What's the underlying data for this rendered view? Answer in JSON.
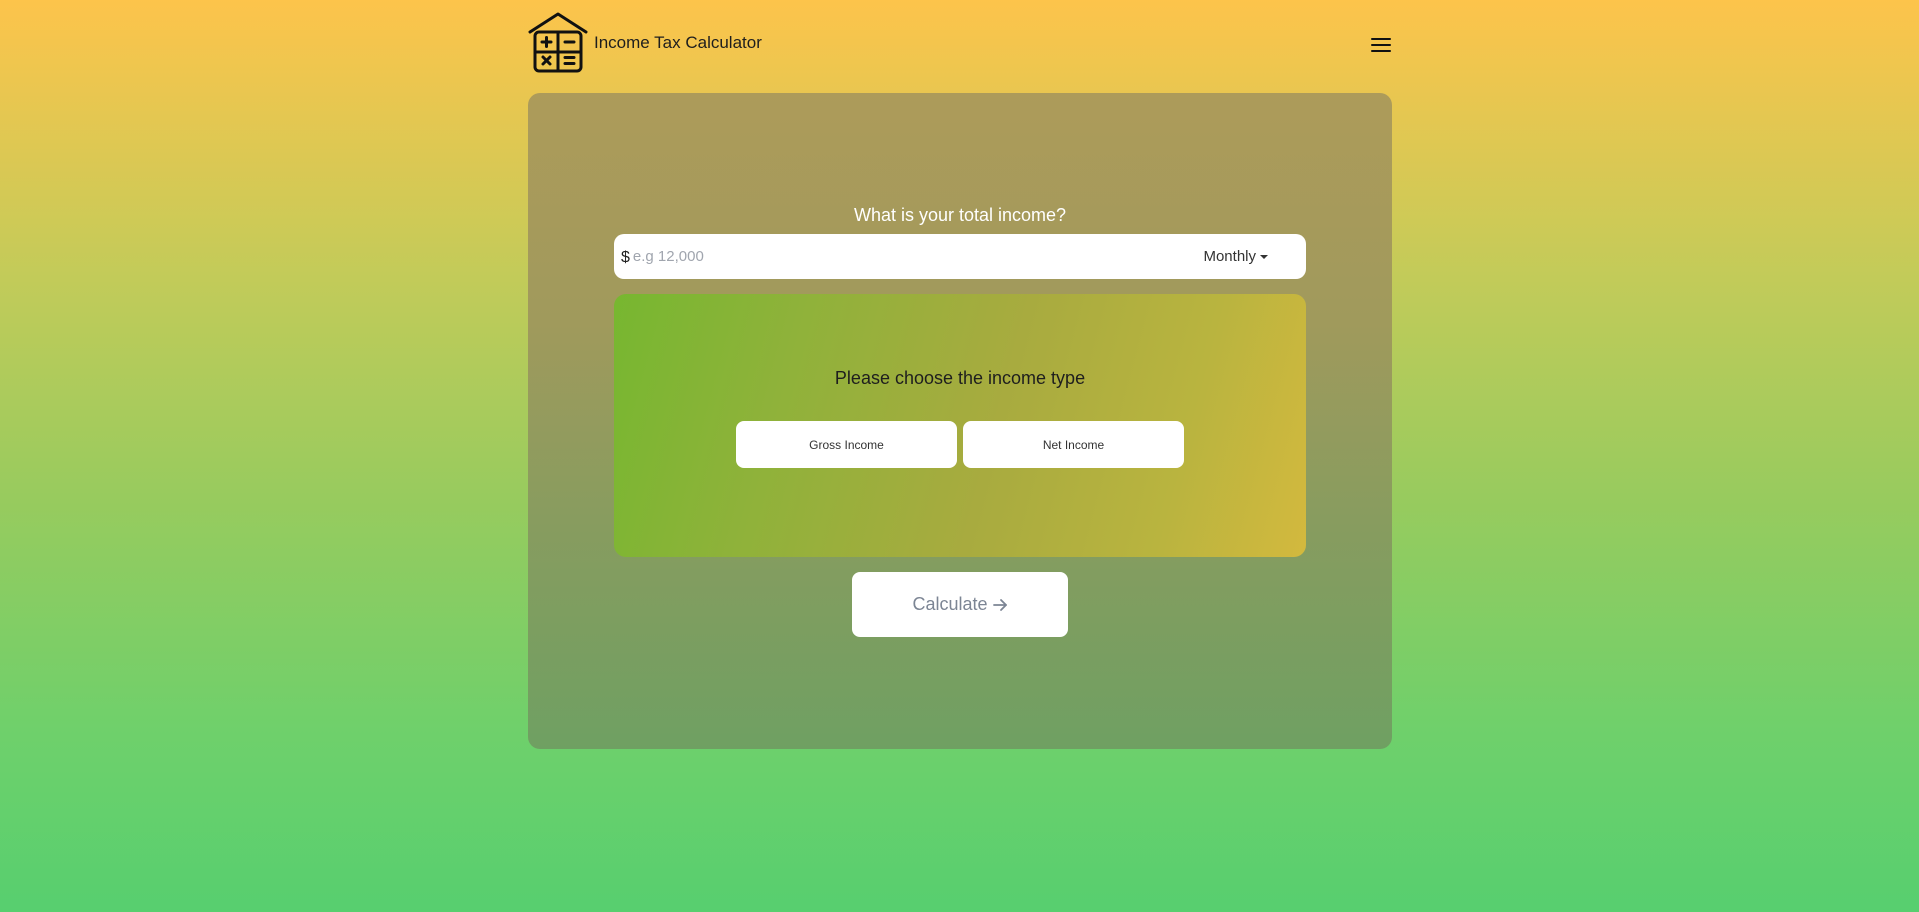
{
  "header": {
    "app_title": "Income Tax Calculator",
    "logo_icon": "house-calculator-icon",
    "menu_icon": "hamburger-menu-icon"
  },
  "income": {
    "question": "What is your total income?",
    "currency_symbol": "$",
    "amount_value": "",
    "amount_placeholder": "e.g 12,000",
    "period_selected": "Monthly",
    "period_icon": "caret-down-icon"
  },
  "income_type": {
    "prompt": "Please choose the income type",
    "options": [
      "Gross Income",
      "Net Income"
    ]
  },
  "actions": {
    "calculate_label": "Calculate",
    "calculate_icon": "arrow-right-icon"
  },
  "colors": {
    "background_top": "#fdc44b",
    "background_bottom": "#57cf6f",
    "panel_green": "#77b730",
    "panel_gold": "#d3b93e"
  }
}
